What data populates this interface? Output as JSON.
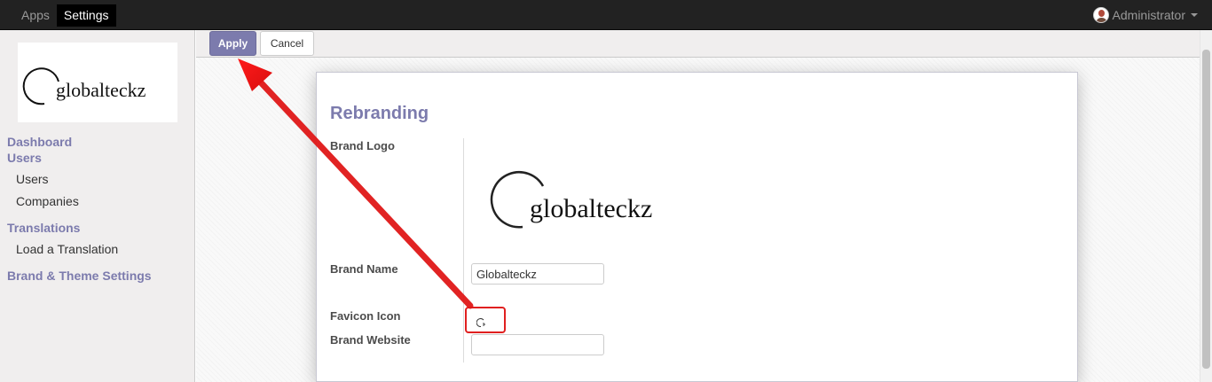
{
  "topbar": {
    "menu": [
      {
        "label": "Apps",
        "active": false
      },
      {
        "label": "Settings",
        "active": true
      }
    ],
    "user": "Administrator"
  },
  "sidebar": {
    "logo_text": "globalteckz",
    "sections": [
      {
        "label": "Dashboard"
      },
      {
        "label": "Users",
        "items": [
          "Users",
          "Companies"
        ]
      },
      {
        "label": "Translations",
        "items": [
          "Load a Translation"
        ]
      },
      {
        "label": "Brand & Theme Settings"
      }
    ]
  },
  "toolbar": {
    "apply_label": "Apply",
    "cancel_label": "Cancel"
  },
  "form": {
    "title": "Rebranding",
    "brand_logo_label": "Brand Logo",
    "brand_logo_text": "globalteckz",
    "brand_name_label": "Brand Name",
    "brand_name_value": "Globalteckz",
    "favicon_label": "Favicon Icon",
    "brand_website_label": "Brand Website",
    "brand_website_value": ""
  },
  "colors": {
    "accent": "#7c7bad",
    "annotation": "#e02020",
    "topbar": "#222222"
  }
}
